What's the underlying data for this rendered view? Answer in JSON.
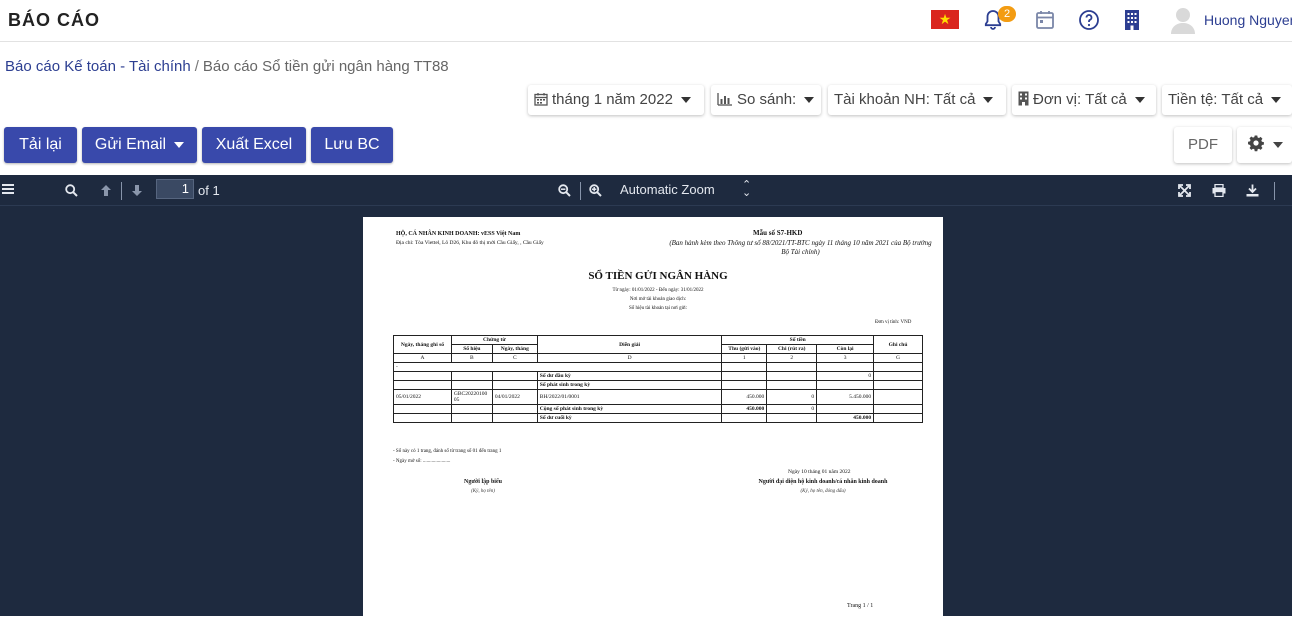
{
  "header": {
    "title": "BÁO CÁO",
    "notification_count": "2",
    "user_name": "Huong Nguyen"
  },
  "breadcrumb": {
    "parent": "Báo cáo Kế toán - Tài chính",
    "separator": "/",
    "current": "Báo cáo Sổ tiền gửi ngân hàng TT88"
  },
  "filters": {
    "period": "tháng 1 năm 2022",
    "compare": "So sánh:",
    "bank_account": "Tài khoản NH: Tất cả",
    "unit": "Đơn vị: Tất cả",
    "currency": "Tiền tệ: Tất cả"
  },
  "actions": {
    "reload": "Tải lại",
    "send_email": "Gửi Email",
    "export_excel": "Xuất Excel",
    "save_report": "Lưu BC",
    "pdf": "PDF"
  },
  "viewer": {
    "page_number": "1",
    "page_count": "of 1",
    "zoom": "Automatic Zoom"
  },
  "report": {
    "org_name": "HỘ, CÁ NHÂN KINH DOANH: vESS Việt Nam",
    "org_address": "Địa chỉ: Tòa Viettel, Lô D26, Khu đô thị mới Cầu Giấy, , Cầu Giấy",
    "form_code": "Mẫu số S7-HKD",
    "form_basis": "(Ban hành kèm theo Thông tư số 88/2021/TT-BTC ngày 11 tháng 10 năm 2021 của Bộ trưởng Bộ Tài chính)",
    "title": "SỔ TIỀN GỬI NGÂN HÀNG",
    "date_range": "Từ ngày: 01/01/2022 - Đến ngày: 31/01/2022",
    "bank_place": "Nơi mở tài khoản giao dịch:",
    "account_no": "Số hiệu tài khoản tại nơi gửi:",
    "currency_unit": "Đơn vị tính: VND",
    "columns": {
      "date": "Ngày, tháng ghi sổ",
      "voucher": "Chứng từ",
      "voucher_no": "Số hiệu",
      "voucher_date": "Ngày, tháng",
      "description": "Diễn giải",
      "amount": "Số tiền",
      "deposit": "Thu (gửi vào)",
      "withdraw": "Chi (rút ra)",
      "balance": "Còn lại",
      "note": "Ghi chú"
    },
    "col_codes": [
      "A",
      "B",
      "C",
      "D",
      "1",
      "2",
      "3",
      "G"
    ],
    "dash": "-",
    "opening_label": "Số dư đầu kỳ",
    "opening_value": "0",
    "arising_label": "Số phát sinh trong kỳ",
    "row": {
      "date": "05/01/2022",
      "voucher_no": "GBC2022010005",
      "voucher_date": "04/01/2022",
      "description": "BH/2022/01/0001",
      "deposit": "450.000",
      "withdraw": "0",
      "balance": "5.450.000"
    },
    "total_label": "Cộng số phát sinh trong kỳ",
    "total_deposit": "450.000",
    "total_withdraw": "0",
    "closing_label": "Số dư cuối kỳ",
    "closing_value": "450.000",
    "note_pages": "- Sổ này có 1 trang, đánh số từ trang số 01 đến trang 1",
    "note_open_date": "- Ngày mở sổ: ......................",
    "sign_date": "Ngày 10 tháng 01 năm 2022",
    "preparer": "Người lập biểu",
    "preparer_hint": "(Ký, họ tên)",
    "representative": "Người đại diện hộ kinh doanh/cá nhân kinh doanh",
    "representative_hint": "(Ký, họ tên, đóng dấu)",
    "page_footer": "Trang 1 /  1"
  },
  "colors": {
    "primary": "#3949ab",
    "link": "#2c3e91",
    "viewer_bg": "#1e2a3f",
    "badge": "#f39c12",
    "flag": "#da251d"
  }
}
